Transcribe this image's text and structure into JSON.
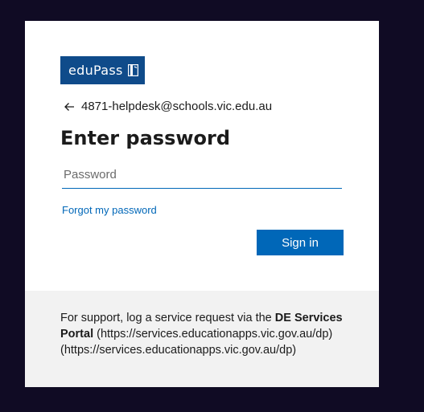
{
  "logo": {
    "text": "eduPass",
    "icon": "book-icon",
    "color": "#0f4b8a"
  },
  "identity": {
    "back_icon": "back-arrow-icon",
    "email": "4871-helpdesk@schools.vic.edu.au"
  },
  "title": "Enter password",
  "password": {
    "value": "",
    "placeholder": "Password"
  },
  "forgot_link": "Forgot my password",
  "signin_button": "Sign in",
  "support": {
    "prefix": "For support, log a service request via the ",
    "portal_name": "DE Services Portal",
    "url1": " (https://services.educationapps.vic.gov.au/dp) ",
    "url2": "(https://services.educationapps.vic.gov.au/dp)"
  },
  "colors": {
    "background": "#100b24",
    "accent": "#0067b8",
    "footer": "#f2f2f2"
  }
}
